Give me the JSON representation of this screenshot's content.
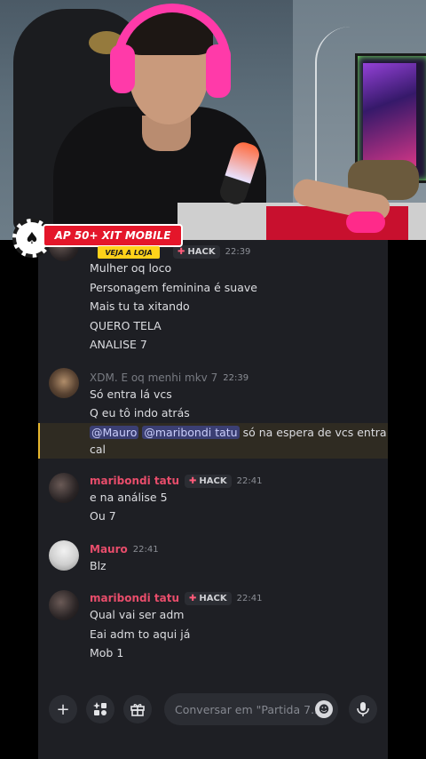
{
  "promo": {
    "banner_text": "AP 50+ XIT MOBILE",
    "cta_text": "VEJA A LOJA",
    "chip_icon": "spade-icon"
  },
  "messages": {
    "partial_group": {
      "lines": [
        "Mulher oq loco",
        "Personagem feminina é suave",
        "Mais tu ta xitando",
        "QUERO TELA",
        "ANALISE 7"
      ],
      "tag": "HACK",
      "time": "22:39"
    },
    "group2": {
      "username": "XDM. E oq menhi mkv 7",
      "time": "22:39",
      "lines": [
        "Só entra lá vcs",
        "Q eu tô indo atrás"
      ],
      "mention_line": {
        "mention1": "@Mauro",
        "mention2": "@maribondi tatu",
        "text": " só na espera de vcs entra",
        "text2": "cal"
      }
    },
    "group3": {
      "username": "maribondi tatu",
      "tag": "HACK",
      "time": "22:41",
      "lines": [
        "e na análise 5",
        "Ou 7"
      ]
    },
    "group4": {
      "username": "Mauro",
      "time": "22:41",
      "lines": [
        "Blz"
      ]
    },
    "group5": {
      "username": "maribondi tatu",
      "tag": "HACK",
      "time": "22:41",
      "lines": [
        "Qual vai ser adm",
        "Eai adm to aqui já",
        "Mob 1"
      ]
    }
  },
  "composer": {
    "placeholder": "Conversar em \"Partida 7..."
  },
  "colors": {
    "chat_bg": "#1e1f24",
    "username_pink": "#e84d6b",
    "mention_highlight": "#e7b72e"
  }
}
